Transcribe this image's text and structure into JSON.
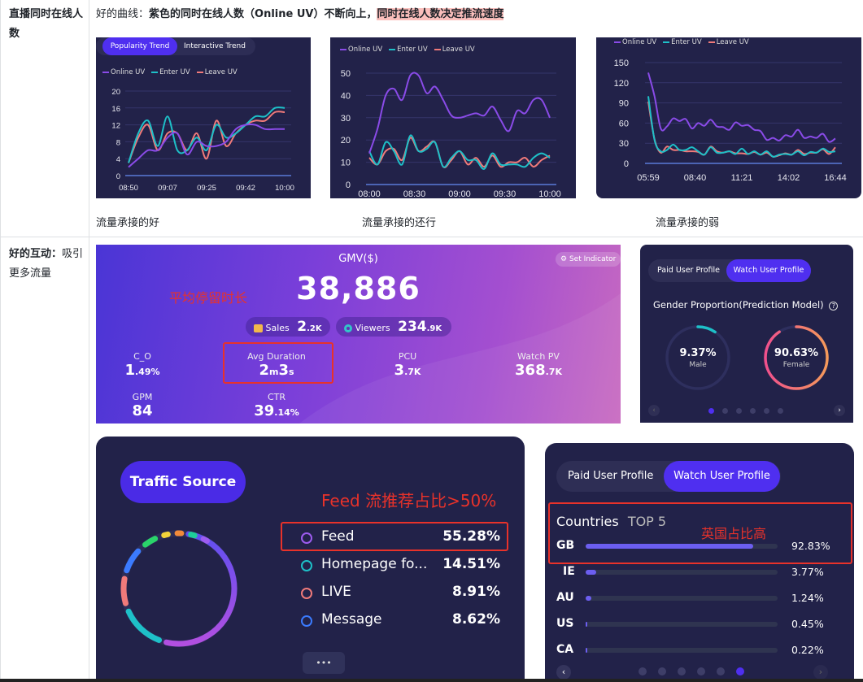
{
  "rows": [
    {
      "header_bold": "直播同时在线人数",
      "caption": {
        "prefix": "好的曲线：",
        "bold": "紫色的同时在线人数（Online UV）不断向上，",
        "highlight": "同时在线人数决定推流速度"
      },
      "sub_captions": [
        "流量承接的好",
        "流量承接的还行",
        "流量承接的弱"
      ]
    },
    {
      "header_bold": "好的互动：",
      "header_normal": "吸引更多流量"
    }
  ],
  "chart1_tabs": [
    "Popularity Trend",
    "Interactive Trend"
  ],
  "legend": [
    "Online UV",
    "Enter UV",
    "Leave UV"
  ],
  "colors": {
    "online": "#8a4be8",
    "enter": "#1ec0c8",
    "leave": "#f07a7a",
    "accent": "#4f2ff0",
    "annot": "#e8322a"
  },
  "chart_data": [
    {
      "type": "line",
      "title": "Popularity Trend",
      "x": [
        "08:50",
        "",
        "",
        "",
        "09:07",
        "",
        "",
        "",
        "09:25",
        "",
        "",
        "",
        "09:42",
        "",
        "",
        "",
        "10:00"
      ],
      "x_ticks": [
        "08:50",
        "09:07",
        "09:25",
        "09:42",
        "10:00"
      ],
      "ylim": [
        0,
        20
      ],
      "y_ticks": [
        "0",
        "4",
        "8",
        "12",
        "16",
        "20"
      ],
      "series": [
        {
          "name": "Online UV",
          "values": [
            2,
            4,
            6,
            6,
            9,
            10,
            5,
            8,
            7,
            7,
            8,
            11,
            12,
            12,
            11,
            11,
            11
          ]
        },
        {
          "name": "Enter UV",
          "values": [
            3,
            10,
            13,
            7,
            14,
            6,
            6,
            9,
            6,
            12,
            9,
            10,
            12,
            14,
            14,
            16,
            16
          ]
        },
        {
          "name": "Leave UV",
          "values": [
            3,
            9,
            12,
            6,
            10,
            10,
            6,
            10,
            4,
            13,
            7,
            10,
            12,
            13,
            13,
            15,
            15
          ]
        }
      ]
    },
    {
      "type": "line",
      "x_ticks": [
        "08:00",
        "08:30",
        "09:00",
        "09:30",
        "10:00"
      ],
      "ylim": [
        0,
        50
      ],
      "y_ticks": [
        "0",
        "10",
        "20",
        "30",
        "40",
        "50"
      ],
      "series": [
        {
          "name": "Online UV",
          "values": [
            14,
            25,
            40,
            43,
            38,
            49,
            49,
            41,
            44,
            38,
            31,
            30,
            31,
            32,
            31,
            35,
            29,
            24,
            33,
            32,
            38,
            38,
            30
          ]
        },
        {
          "name": "Enter UV",
          "values": [
            15,
            9,
            19,
            15,
            9,
            22,
            15,
            16,
            19,
            8,
            12,
            15,
            11,
            11,
            7,
            14,
            9,
            9,
            9,
            8,
            12,
            14,
            12
          ]
        },
        {
          "name": "Leave UV",
          "values": [
            12,
            9,
            15,
            16,
            11,
            21,
            15,
            17,
            19,
            8,
            11,
            15,
            9,
            12,
            8,
            13,
            8,
            10,
            10,
            12,
            8,
            11,
            13
          ]
        }
      ]
    },
    {
      "type": "line",
      "x_ticks": [
        "05:59",
        "08:40",
        "11:21",
        "14:02",
        "16:44"
      ],
      "ylim": [
        0,
        150
      ],
      "y_ticks": [
        "0",
        "30",
        "60",
        "90",
        "120",
        "150"
      ],
      "series": [
        {
          "name": "Online UV",
          "values": [
            135,
            100,
            52,
            55,
            67,
            63,
            66,
            52,
            60,
            56,
            65,
            55,
            54,
            50,
            61,
            56,
            57,
            50,
            48,
            35,
            38,
            34,
            42,
            40,
            50,
            38,
            40,
            38,
            44,
            32,
            37
          ]
        },
        {
          "name": "Enter UV",
          "values": [
            100,
            35,
            18,
            20,
            28,
            20,
            20,
            24,
            18,
            13,
            24,
            16,
            16,
            18,
            14,
            22,
            14,
            18,
            13,
            18,
            10,
            13,
            14,
            13,
            18,
            12,
            17,
            16,
            22,
            17,
            18
          ]
        },
        {
          "name": "Leave UV",
          "values": [
            92,
            36,
            16,
            25,
            20,
            20,
            18,
            18,
            17,
            13,
            25,
            18,
            16,
            18,
            15,
            15,
            14,
            17,
            13,
            16,
            10,
            12,
            15,
            13,
            20,
            14,
            16,
            16,
            21,
            14,
            24
          ]
        }
      ]
    },
    {
      "type": "pie",
      "title": "Traffic Source",
      "categories": [
        "Feed",
        "Homepage fo...",
        "LIVE",
        "Message"
      ],
      "values": [
        55.28,
        14.51,
        8.91,
        8.62
      ]
    },
    {
      "type": "bar",
      "title": "Countries TOP 5",
      "categories": [
        "GB",
        "IE",
        "AU",
        "US",
        "CA"
      ],
      "values": [
        92.83,
        3.77,
        1.24,
        0.45,
        0.22
      ]
    }
  ],
  "gmv": {
    "title": "GMV($)",
    "value": "38,886",
    "set_indicator": "Set Indicator",
    "annotation": "平均停留时长",
    "sales_label": "Sales",
    "sales_value": "2",
    "sales_unit": ".2K",
    "viewers_label": "Viewers",
    "viewers_value": "234",
    "viewers_unit": ".9K",
    "metrics": [
      {
        "label": "C_O",
        "value": "1",
        "unit": ".49%"
      },
      {
        "label": "Avg Duration",
        "value": "2",
        "unit": "m",
        "value2": "3",
        "unit2": "s"
      },
      {
        "label": "PCU",
        "value": "3",
        "unit": ".7K"
      },
      {
        "label": "Watch PV",
        "value": "368",
        "unit": ".7K"
      },
      {
        "label": "GPM",
        "value": "84",
        "unit": ""
      },
      {
        "label": "CTR",
        "value": "39",
        "unit": ".14%"
      }
    ]
  },
  "gender": {
    "tabs": [
      "Paid User Profile",
      "Watch User Profile"
    ],
    "title": "Gender Proportion(Prediction Model)",
    "male_pct": "9.37%",
    "male_label": "Male",
    "male_fraction": 0.0937,
    "female_pct": "90.63%",
    "female_label": "Female",
    "female_fraction": 0.9063,
    "page_active": 1,
    "page_count": 6
  },
  "traffic": {
    "title": "Traffic Source",
    "annotation": "Feed 流推荐占比>50%",
    "items": [
      {
        "label": "Feed",
        "value": "55.28%"
      },
      {
        "label": "Homepage fo...",
        "value": "14.51%"
      },
      {
        "label": "LIVE",
        "value": "8.91%"
      },
      {
        "label": "Message",
        "value": "8.62%"
      }
    ],
    "more": "•••"
  },
  "countries": {
    "tabs": [
      "Paid User Profile",
      "Watch User Profile"
    ],
    "title": "Countries",
    "title_suffix": "TOP 5",
    "annotation": "英国占比高",
    "items": [
      {
        "code": "GB",
        "value": "92.83%",
        "fraction": 0.9283
      },
      {
        "code": "IE",
        "value": "3.77%",
        "fraction": 0.0377
      },
      {
        "code": "AU",
        "value": "1.24%",
        "fraction": 0.0124
      },
      {
        "code": "US",
        "value": "0.45%",
        "fraction": 0.0045
      },
      {
        "code": "CA",
        "value": "0.22%",
        "fraction": 0.0022
      }
    ],
    "page_active": 6,
    "page_count": 6
  }
}
